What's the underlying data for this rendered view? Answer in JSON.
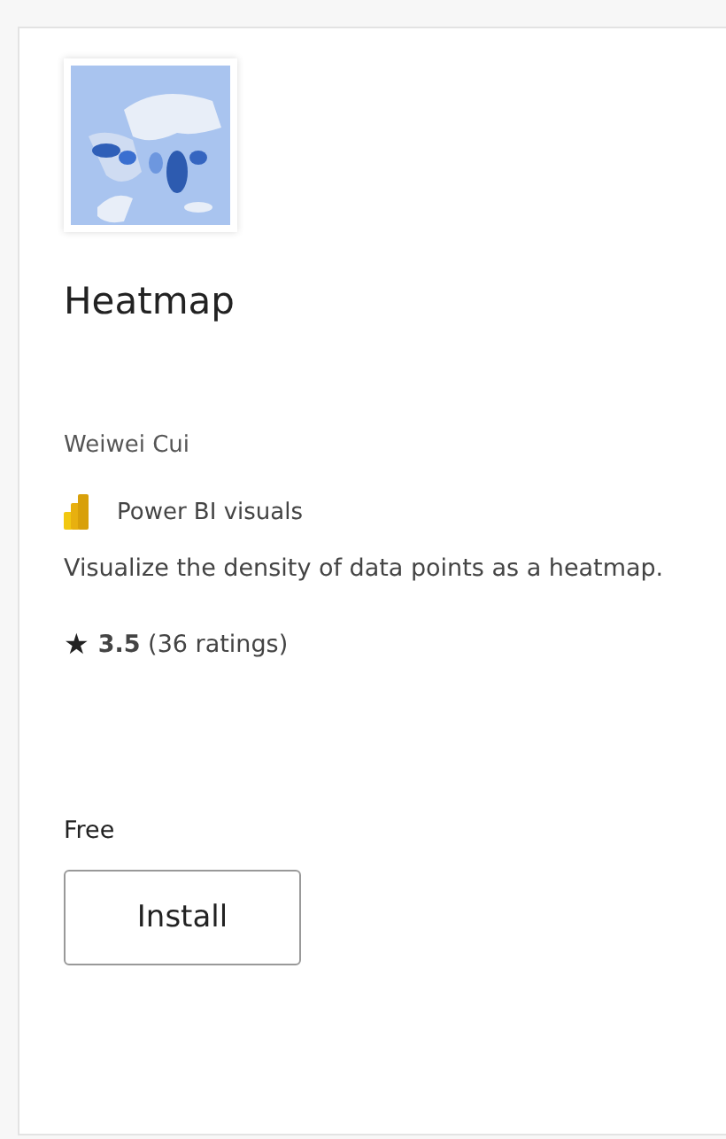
{
  "card": {
    "title": "Heatmap",
    "author": "Weiwei Cui",
    "publisher": "Power BI visuals",
    "description": "Visualize the density of data points as a heatmap.",
    "rating_icon": "★",
    "rating": "**3.5** (36 ratings)",
    "price": "Free",
    "button": "Install"
  }
}
